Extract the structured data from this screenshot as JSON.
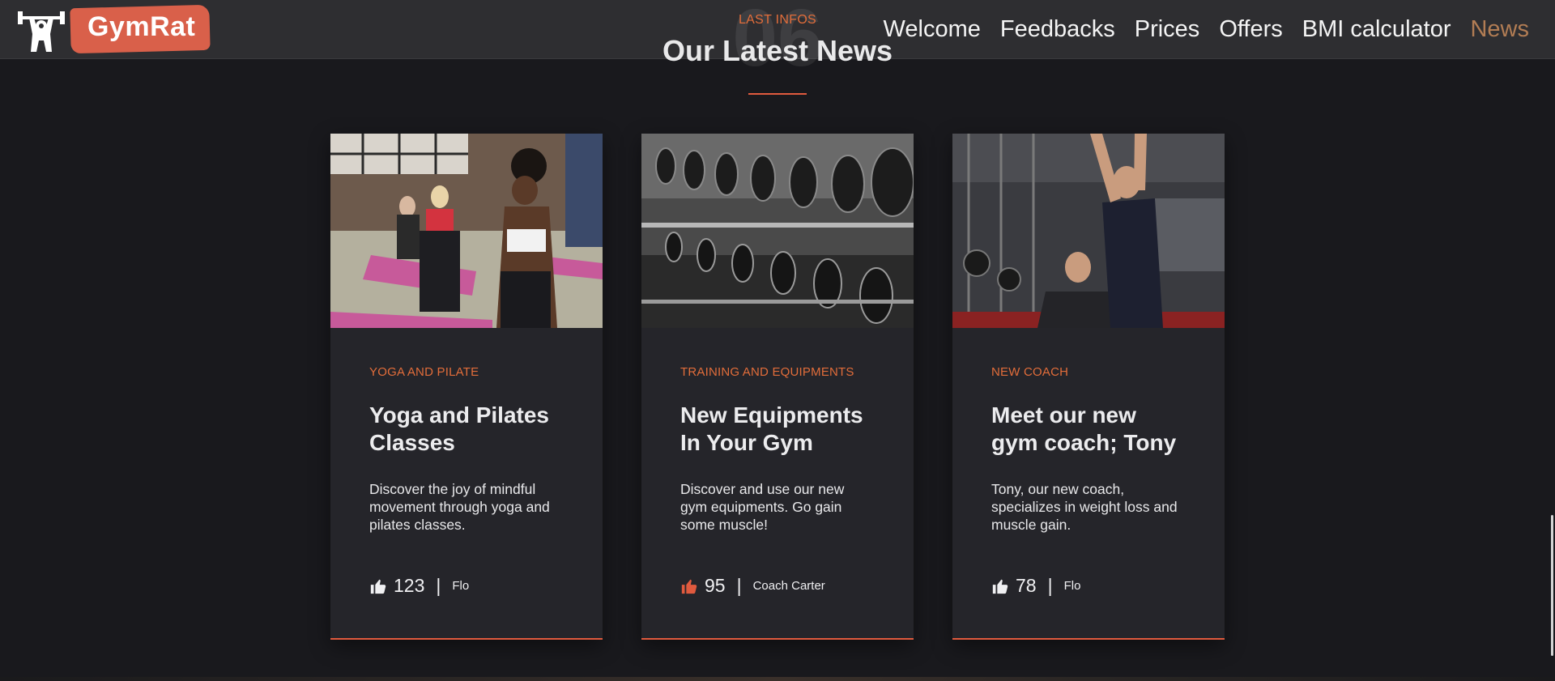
{
  "brand": {
    "name": "GymRat",
    "accent": "#d9604a"
  },
  "nav": {
    "items": [
      {
        "label": "Welcome",
        "active": false
      },
      {
        "label": "Feedbacks",
        "active": false
      },
      {
        "label": "Prices",
        "active": false
      },
      {
        "label": "Offers",
        "active": false
      },
      {
        "label": "BMI calculator",
        "active": false
      },
      {
        "label": "News",
        "active": true
      }
    ],
    "active_color": "#b27d54"
  },
  "section": {
    "number": "06",
    "kicker": "LAST INFOS",
    "title": "Our Latest News"
  },
  "cards": [
    {
      "image": "yoga-class-photo",
      "category": "YOGA AND PILATE",
      "title": "Yoga and Pilates Classes",
      "text": "Discover the joy of mindful movement through yoga and pilates classes.",
      "likes": "123",
      "liked": false,
      "author": "Flo"
    },
    {
      "image": "dumbbell-rack-photo",
      "category": "TRAINING AND EQUIPMENTS",
      "title": "New Equipments In Your Gym",
      "text": "Discover and use our new gym equipments. Go gain some muscle!",
      "likes": "95",
      "liked": true,
      "author": "Coach Carter"
    },
    {
      "image": "coach-photo",
      "category": "NEW COACH",
      "title": "Meet our new gym coach; Tony",
      "text": "Tony, our new coach, specializes in weight loss and muscle gain.",
      "likes": "78",
      "liked": false,
      "author": "Flo"
    }
  ],
  "colors": {
    "background": "#19191d",
    "card": "#25252a",
    "accent_orange": "#e26d3a",
    "liked_icon": "#e05a3e"
  }
}
